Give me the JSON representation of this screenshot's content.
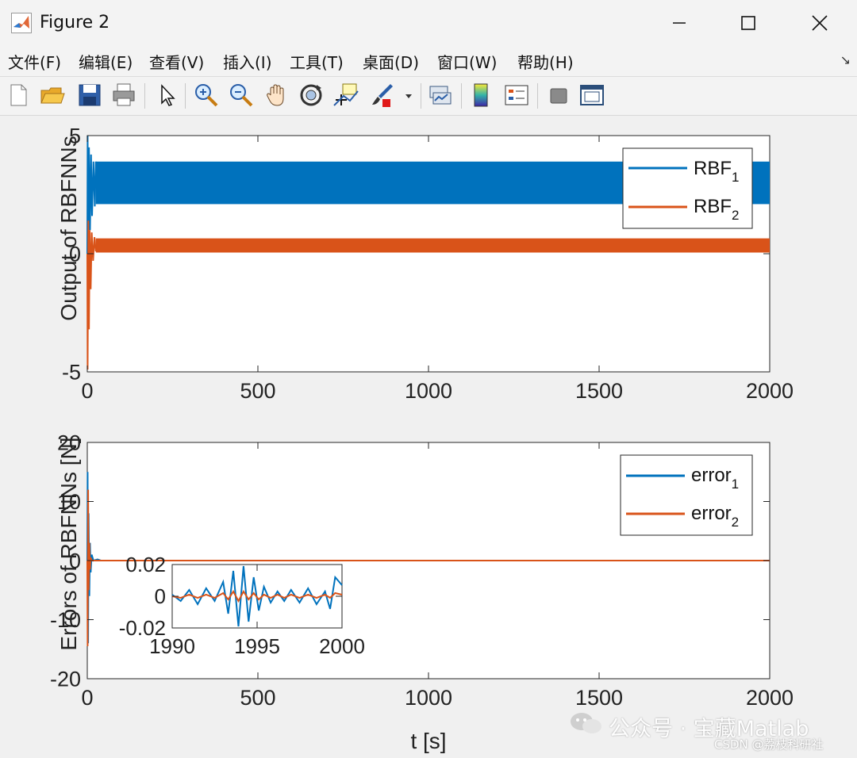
{
  "window": {
    "title": "Figure 2"
  },
  "menu": [
    "文件(F)",
    "编辑(E)",
    "查看(V)",
    "插入(I)",
    "工具(T)",
    "桌面(D)",
    "窗口(W)",
    "帮助(H)"
  ],
  "toolbar": [
    "new-file-icon",
    "open-folder-icon",
    "save-icon",
    "print-icon",
    "pointer-icon",
    "zoom-in-icon",
    "zoom-out-icon",
    "pan-hand-icon",
    "rotate-3d-icon",
    "data-cursor-icon",
    "brush-icon",
    "link-plot-icon",
    "colorbar-icon",
    "legend-icon",
    "hide-tools-icon",
    "dock-icon"
  ],
  "colors": {
    "series1": "#0072bd",
    "series2": "#d95319"
  },
  "watermark": {
    "text": "公众号 · 宝藏Matlab",
    "csdn": "CSDN @荔枝科研社"
  },
  "chart_data": [
    {
      "type": "line",
      "ylabel": "Output of RBFNNs",
      "xlim": [
        0,
        2000
      ],
      "ylim": [
        -5,
        5
      ],
      "xticks": [
        "0",
        "500",
        "1000",
        "1500",
        "2000"
      ],
      "yticks": [
        "-5",
        "0",
        "5"
      ],
      "legend_position": "top-right",
      "series": [
        {
          "name": "RBF",
          "sub": "1",
          "band": [
            2.1,
            3.9
          ],
          "initial_peak": 5,
          "initial_trough": -0.3
        },
        {
          "name": "RBF",
          "sub": "2",
          "band": [
            0.05,
            0.65
          ],
          "initial_peak": 1.4,
          "initial_trough": -4.9
        }
      ]
    },
    {
      "type": "line",
      "ylabel": "Errors of RBFNNs [N]",
      "xlabel": "t [s]",
      "xlim": [
        0,
        2000
      ],
      "ylim": [
        -20,
        20
      ],
      "xticks": [
        "0",
        "500",
        "1000",
        "1500",
        "2000"
      ],
      "yticks": [
        "-20",
        "-10",
        "0",
        "10",
        "20"
      ],
      "legend_position": "top-right",
      "series": [
        {
          "name": "error",
          "sub": "1",
          "initial_peak": 15,
          "initial_trough": -14
        },
        {
          "name": "error",
          "sub": "2",
          "initial_peak": 12,
          "initial_trough": -14.5
        }
      ]
    },
    {
      "type": "line",
      "inset": true,
      "xlim": [
        1990,
        2000
      ],
      "ylim": [
        -0.02,
        0.02
      ],
      "xticks": [
        "1990",
        "1995",
        "2000"
      ],
      "yticks": [
        "-0.02",
        "0",
        "0.02"
      ],
      "series": [
        {
          "name": "error1",
          "x": [
            1990,
            1990.5,
            1991,
            1991.5,
            1992,
            1992.5,
            1993,
            1993.3,
            1993.6,
            1993.9,
            1994.2,
            1994.5,
            1994.8,
            1995.1,
            1995.4,
            1995.8,
            1996.2,
            1996.6,
            1997,
            1997.5,
            1998,
            1998.5,
            1999,
            1999.3,
            1999.6,
            2000
          ],
          "y": [
            0.001,
            -0.003,
            0.004,
            -0.005,
            0.005,
            -0.003,
            0.009,
            -0.011,
            0.016,
            -0.019,
            0.019,
            -0.016,
            0.012,
            -0.009,
            0.006,
            -0.004,
            0.003,
            -0.003,
            0.004,
            -0.004,
            0.005,
            -0.005,
            0.003,
            -0.008,
            0.012,
            0.007
          ]
        },
        {
          "name": "error2",
          "x": [
            1990,
            1990.5,
            1991,
            1991.5,
            1992,
            1992.5,
            1993,
            1993.3,
            1993.6,
            1993.9,
            1994.2,
            1994.5,
            1994.8,
            1995.1,
            1995.4,
            1995.8,
            1996.2,
            1996.6,
            1997,
            1997.5,
            1998,
            1998.5,
            1999,
            1999.3,
            1999.6,
            2000
          ],
          "y": [
            0.0,
            -0.001,
            0.001,
            -0.001,
            0.001,
            -0.001,
            0.002,
            -0.002,
            0.003,
            -0.003,
            0.003,
            -0.002,
            0.002,
            -0.002,
            0.001,
            -0.001,
            0.001,
            -0.001,
            0.001,
            -0.001,
            0.001,
            -0.001,
            0.001,
            -0.001,
            0.002,
            0.001
          ]
        }
      ]
    }
  ]
}
